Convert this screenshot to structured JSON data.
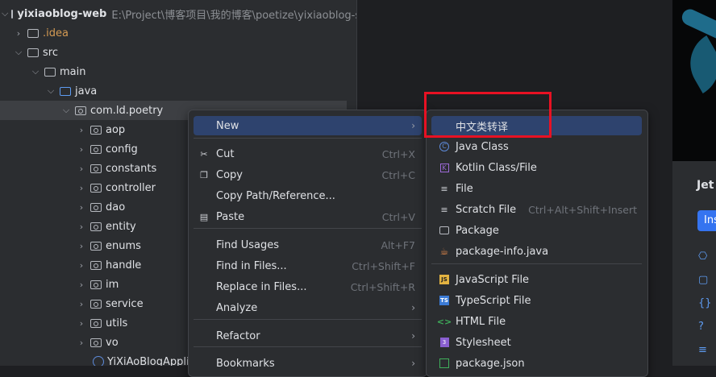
{
  "project_tree": {
    "root": {
      "name": "yixiaoblog-web",
      "path": "E:\\Project\\博客项目\\我的博客\\poetize\\yixiaoblog-serv"
    },
    "idea": ".idea",
    "src": "src",
    "main": "main",
    "java": "java",
    "package": "com.ld.poetry",
    "subpackages": [
      "aop",
      "config",
      "constants",
      "controller",
      "dao",
      "entity",
      "enums",
      "handle",
      "im",
      "service",
      "utils",
      "vo"
    ],
    "app_class": "YiXiAoBlogApplic"
  },
  "context_menu": {
    "items": [
      {
        "label": "New",
        "shortcut": "",
        "has_submenu": true,
        "icon": ""
      },
      {
        "label": "Cut",
        "shortcut": "Ctrl+X",
        "icon": "scissors-icon"
      },
      {
        "label": "Copy",
        "shortcut": "Ctrl+C",
        "icon": "copy-icon"
      },
      {
        "label": "Copy Path/Reference...",
        "shortcut": "",
        "icon": ""
      },
      {
        "label": "Paste",
        "shortcut": "Ctrl+V",
        "icon": "paste-icon"
      },
      {
        "label": "Find Usages",
        "shortcut": "Alt+F7",
        "icon": ""
      },
      {
        "label": "Find in Files...",
        "shortcut": "Ctrl+Shift+F",
        "icon": ""
      },
      {
        "label": "Replace in Files...",
        "shortcut": "Ctrl+Shift+R",
        "icon": ""
      },
      {
        "label": "Analyze",
        "shortcut": "",
        "has_submenu": true,
        "icon": ""
      },
      {
        "label": "Refactor",
        "shortcut": "",
        "has_submenu": true,
        "icon": ""
      },
      {
        "label": "Bookmarks",
        "shortcut": "",
        "has_submenu": true,
        "icon": ""
      }
    ]
  },
  "new_submenu": {
    "items": [
      {
        "label": "中文类转译",
        "shortcut": "",
        "icon": ""
      },
      {
        "label": "Java Class",
        "shortcut": "",
        "icon": "java-class-icon"
      },
      {
        "label": "Kotlin Class/File",
        "shortcut": "",
        "icon": "kotlin-icon"
      },
      {
        "label": "File",
        "shortcut": "",
        "icon": "file-icon"
      },
      {
        "label": "Scratch File",
        "shortcut": "Ctrl+Alt+Shift+Insert",
        "icon": "scratch-file-icon"
      },
      {
        "label": "Package",
        "shortcut": "",
        "icon": "package-icon"
      },
      {
        "label": "package-info.java",
        "shortcut": "",
        "icon": "package-info-icon"
      },
      {
        "label": "JavaScript File",
        "shortcut": "",
        "icon": "javascript-icon"
      },
      {
        "label": "TypeScript File",
        "shortcut": "",
        "icon": "typescript-icon"
      },
      {
        "label": "HTML File",
        "shortcut": "",
        "icon": "html-icon"
      },
      {
        "label": "Stylesheet",
        "shortcut": "",
        "icon": "css-icon"
      },
      {
        "label": "package.json",
        "shortcut": "",
        "icon": "npm-icon"
      }
    ]
  },
  "right_panel": {
    "title": "Jet",
    "button": "Ins"
  },
  "colors": {
    "highlight": "#2e436e",
    "annotation": "#e81123",
    "accent": "#3574f0"
  }
}
